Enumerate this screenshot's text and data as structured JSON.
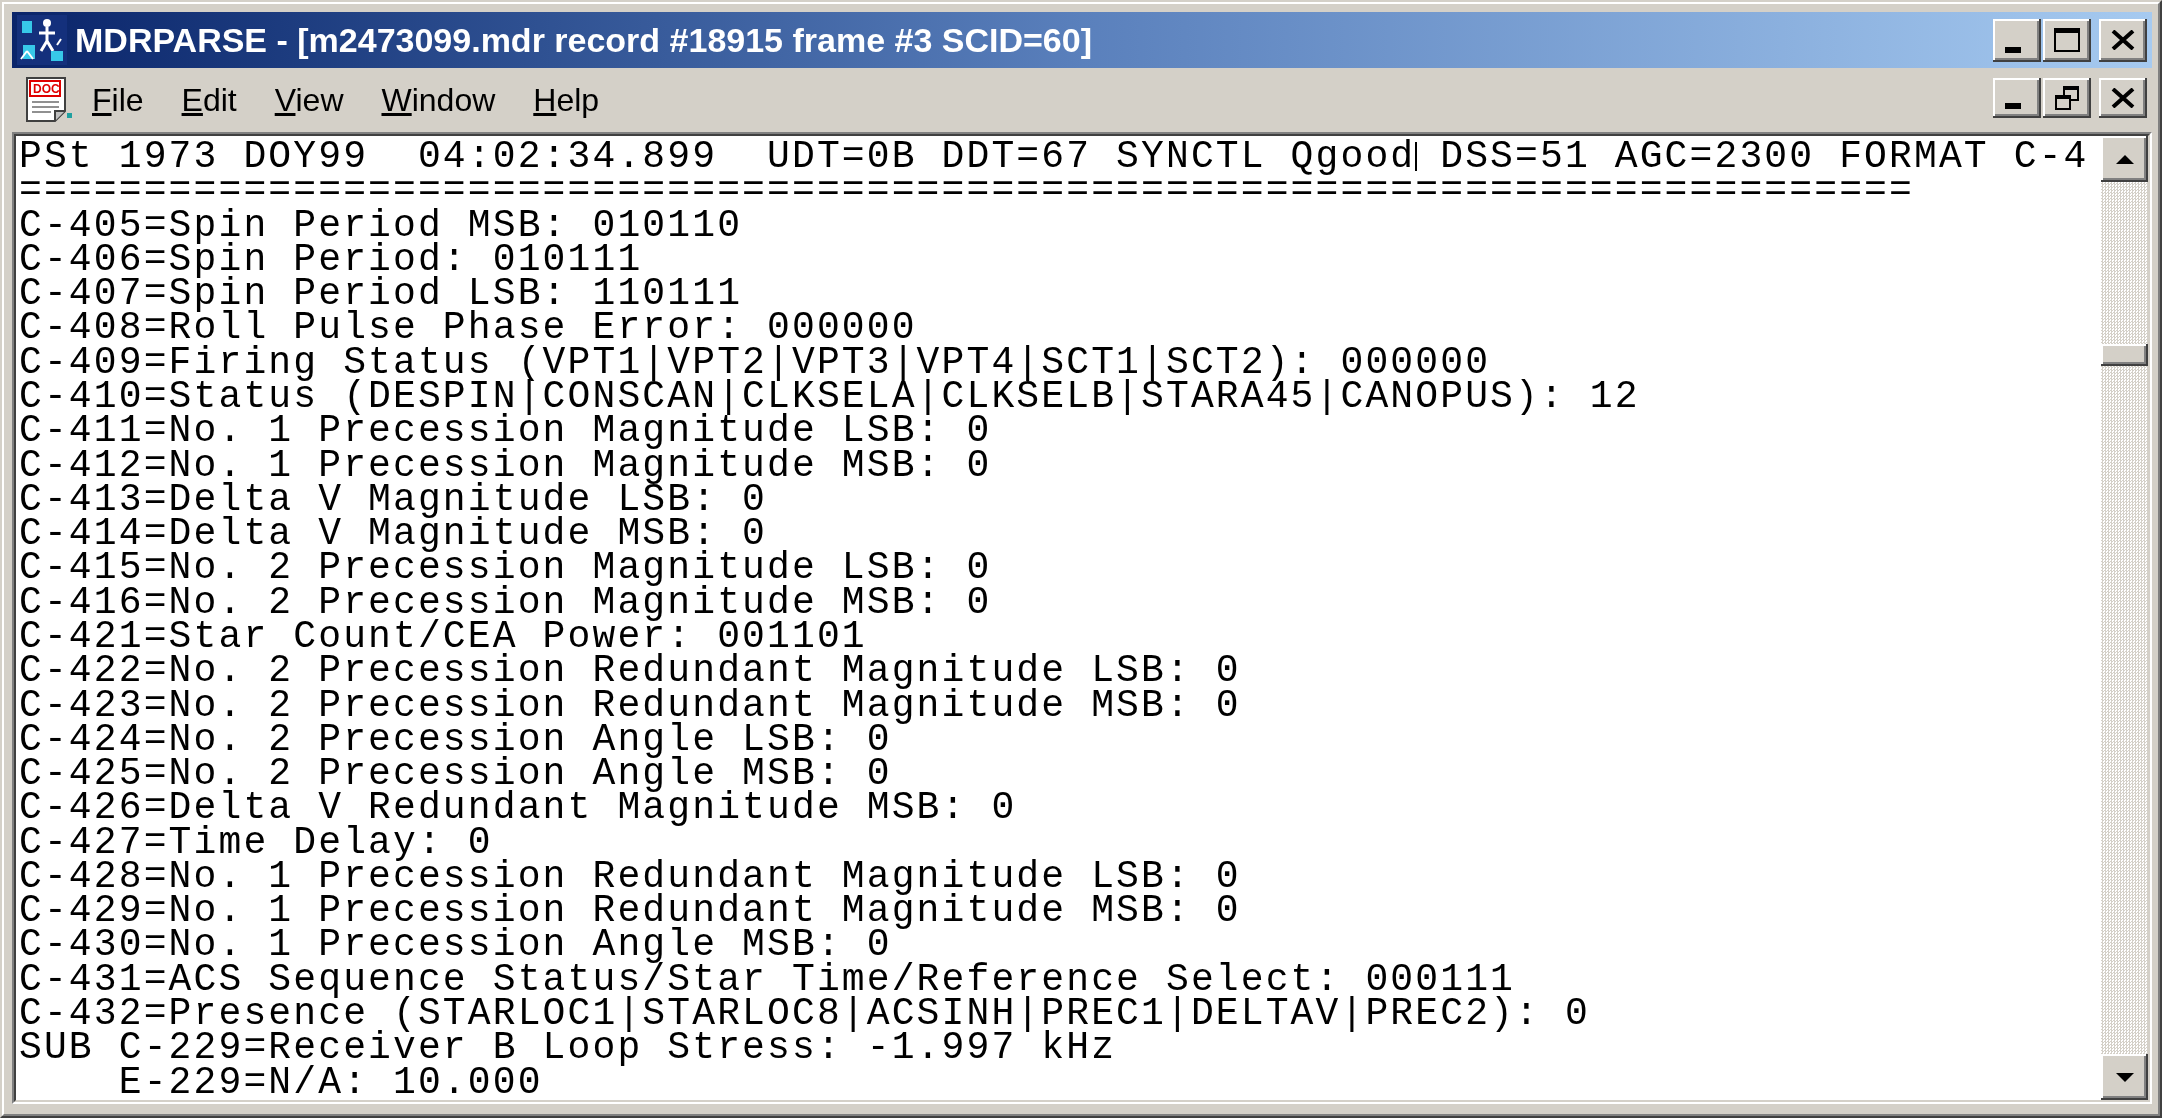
{
  "window": {
    "title": "MDRPARSE - [m2473099.mdr record #18915 frame #3 SCID=60]"
  },
  "menu_bar": {
    "icon_label": "DOC",
    "items": [
      "File",
      "Edit",
      "View",
      "Window",
      "Help"
    ]
  },
  "document": {
    "header": [
      "PSt 1973 DOY99  04:02:34.899  UDT=0B DDT=67 SYNCTL Qgood",
      "DSS=51 AGC=2300 FORMAT C-4"
    ],
    "lines": [
      "============================================================================",
      "C-405=Spin Period MSB: 010110",
      "C-406=Spin Period: 010111",
      "C-407=Spin Period LSB: 110111",
      "C-408=Roll Pulse Phase Error: 000000",
      "C-409=Firing Status (VPT1|VPT2|VPT3|VPT4|SCT1|SCT2): 000000",
      "C-410=Status (DESPIN|CONSCAN|CLKSELA|CLKSELB|STARA45|CANOPUS): 12",
      "C-411=No. 1 Precession Magnitude LSB: 0",
      "C-412=No. 1 Precession Magnitude MSB: 0",
      "C-413=Delta V Magnitude LSB: 0",
      "C-414=Delta V Magnitude MSB: 0",
      "C-415=No. 2 Precession Magnitude LSB: 0",
      "C-416=No. 2 Precession Magnitude MSB: 0",
      "C-421=Star Count/CEA Power: 001101",
      "C-422=No. 2 Precession Redundant Magnitude LSB: 0",
      "C-423=No. 2 Precession Redundant Magnitude MSB: 0",
      "C-424=No. 2 Precession Angle LSB: 0",
      "C-425=No. 2 Precession Angle MSB: 0",
      "C-426=Delta V Redundant Magnitude MSB: 0",
      "C-427=Time Delay: 0",
      "C-428=No. 1 Precession Redundant Magnitude LSB: 0",
      "C-429=No. 1 Precession Redundant Magnitude MSB: 0",
      "C-430=No. 1 Precession Angle MSB: 0",
      "C-431=ACS Sequence Status/Star Time/Reference Select: 000111",
      "C-432=Presence (STARLOC1|STARLOC8|ACSINH|PREC1|DELTAV|PREC2): 0",
      "SUB C-229=Receiver B Loop Stress: -1.997 kHz",
      "    E-229=N/A: 10.000"
    ]
  }
}
